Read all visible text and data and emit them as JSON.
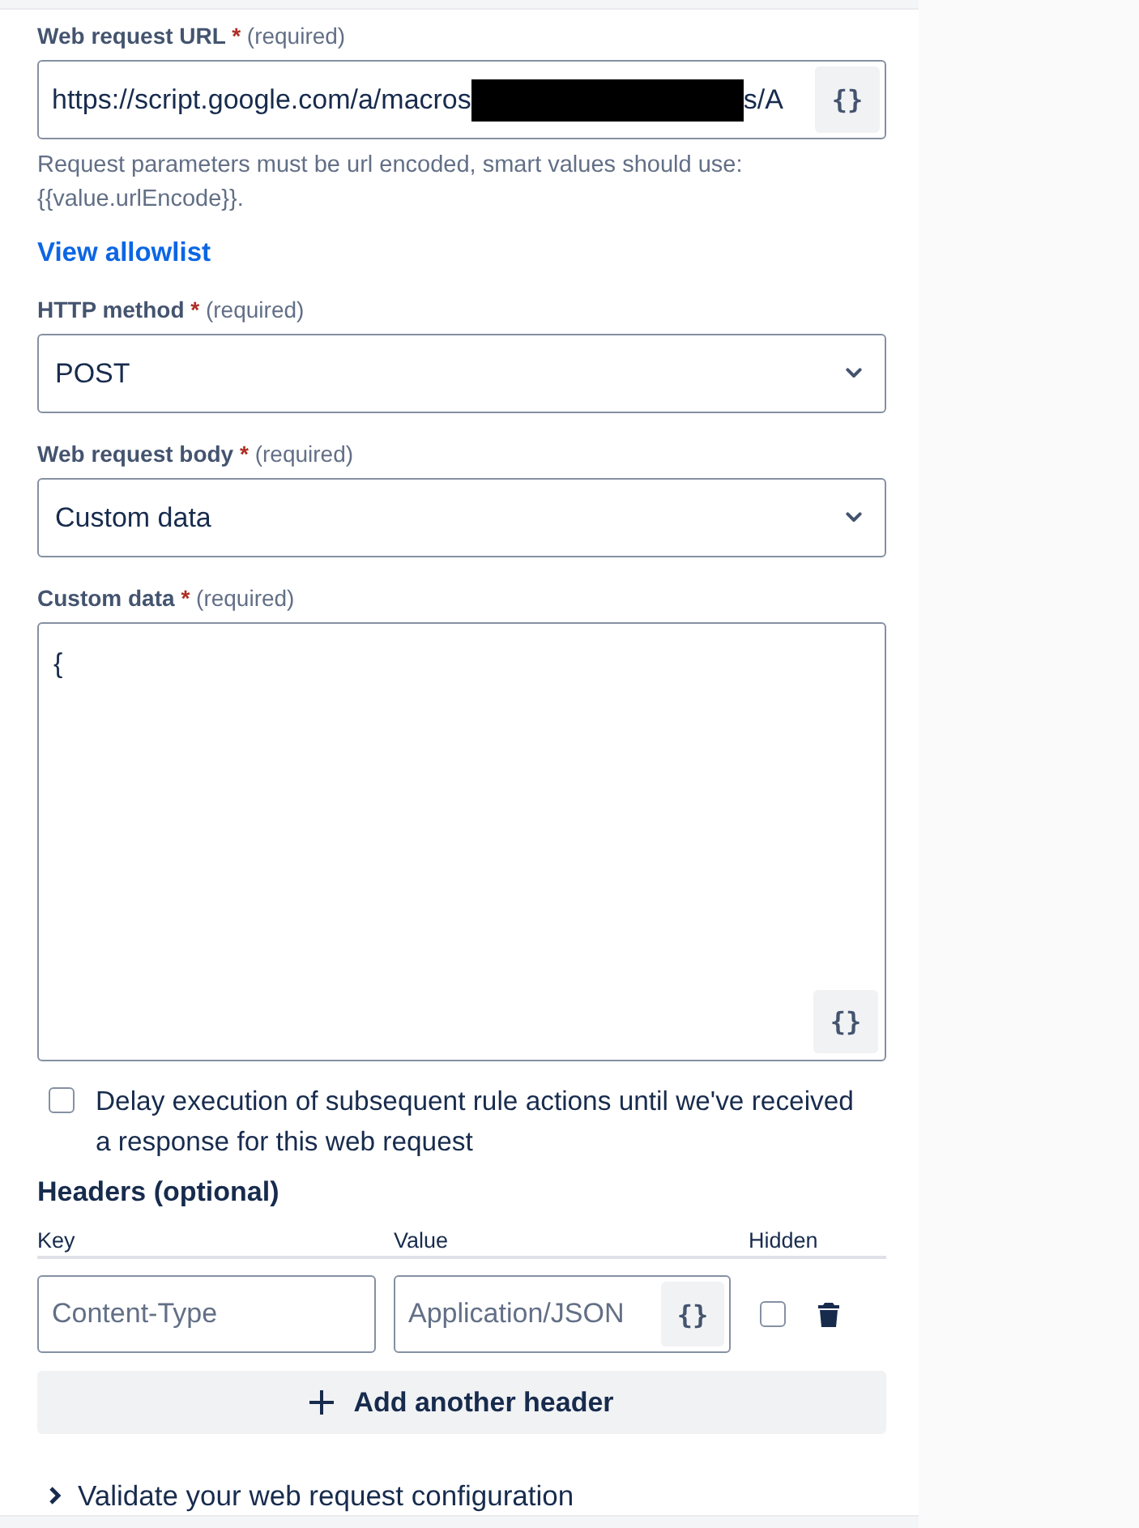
{
  "url_field": {
    "label": "Web request URL",
    "required_mark": "*",
    "required_note": "(required)",
    "value_start": "https://script.google.com/a/macros",
    "redacted": true,
    "value_end": "s/A",
    "smart_button": "{}",
    "helper": "Request parameters must be url encoded, smart values should use: {{value.urlEncode}}."
  },
  "allowlist_link": "View allowlist",
  "http_method": {
    "label": "HTTP method",
    "required_mark": "*",
    "required_note": "(required)",
    "value": "POST"
  },
  "body_type": {
    "label": "Web request body",
    "required_mark": "*",
    "required_note": "(required)",
    "value": "Custom data"
  },
  "custom_data": {
    "label": "Custom data",
    "required_mark": "*",
    "required_note": "(required)",
    "value": "{",
    "smart_button": "{}"
  },
  "delay_option": {
    "label": "Delay execution of subsequent rule actions until we've received a response for this web request",
    "checked": false
  },
  "headers": {
    "title": "Headers (optional)",
    "columns": [
      "Key",
      "Value",
      "Hidden"
    ],
    "rows": [
      {
        "key_placeholder": "Content-Type",
        "value_placeholder": "Application/JSON",
        "smart_button": "{}",
        "hidden": false
      }
    ],
    "add_button": "Add another header"
  },
  "validate_section": {
    "label": "Validate your web request configuration",
    "expanded": false
  }
}
